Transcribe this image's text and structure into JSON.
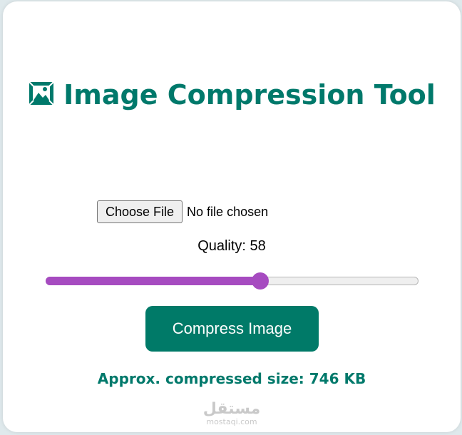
{
  "header": {
    "icon": "framed-picture-icon",
    "title": "Image Compression Tool"
  },
  "file_input": {
    "button_label": "Choose File",
    "status": "No file chosen"
  },
  "quality": {
    "label": "Quality: 58",
    "value": 58,
    "min": 0,
    "max": 100
  },
  "actions": {
    "compress_label": "Compress Image"
  },
  "result": {
    "text": "Approx. compressed size: 746 KB"
  },
  "watermark": {
    "arabic": "مستقل",
    "site": "mostaqi.com"
  },
  "colors": {
    "accent": "#00796b",
    "button": "#007a68",
    "slider": "#a64bc0",
    "background": "#dfe9ec"
  }
}
